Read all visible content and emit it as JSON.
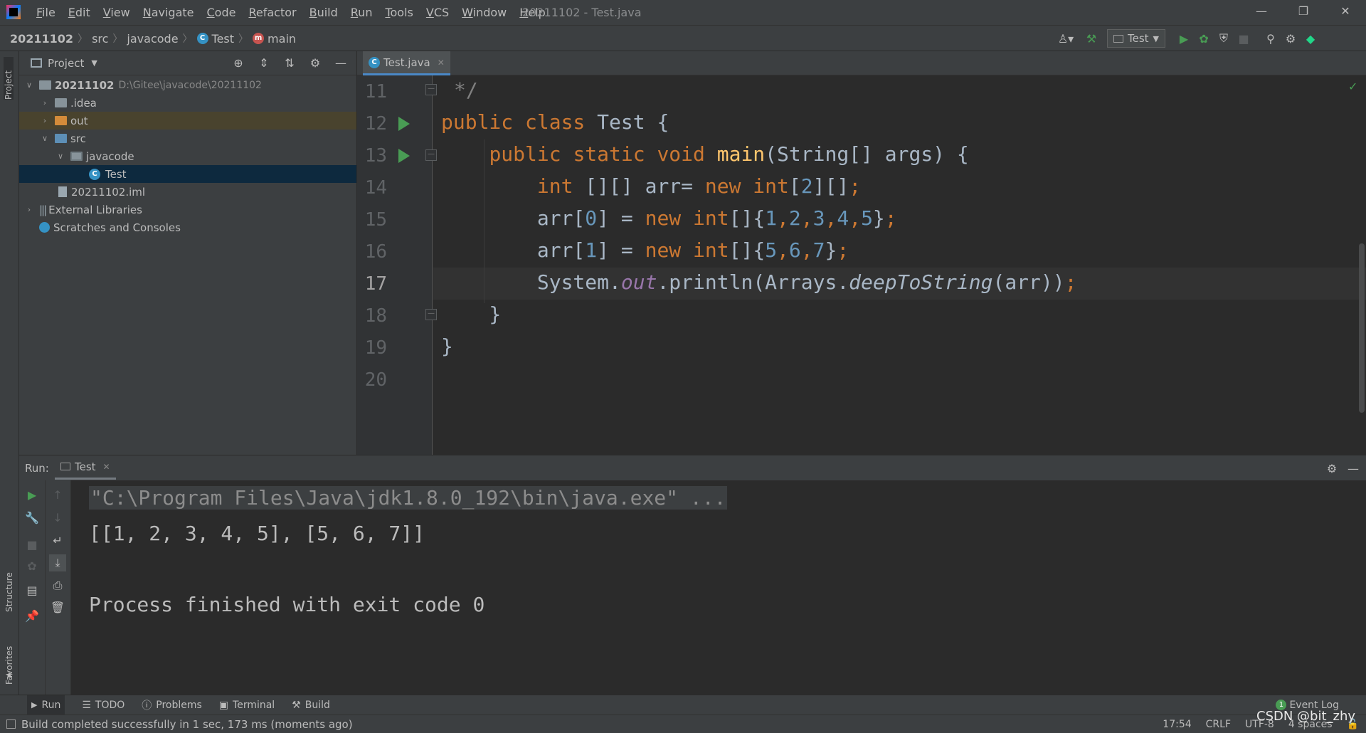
{
  "menu": [
    "File",
    "Edit",
    "View",
    "Navigate",
    "Code",
    "Refactor",
    "Build",
    "Run",
    "Tools",
    "VCS",
    "Window",
    "Help"
  ],
  "window_title": "20211102 - Test.java",
  "breadcrumb": [
    "20211102",
    "src",
    "javacode",
    "Test",
    "main"
  ],
  "run_config": "Test",
  "project_panel": {
    "title": "Project",
    "root_name": "20211102",
    "root_path": "D:\\Gitee\\javacode\\20211102",
    "items": [
      ".idea",
      "out",
      "src",
      "javacode",
      "Test",
      "20211102.iml",
      "External Libraries",
      "Scratches and Consoles"
    ]
  },
  "editor": {
    "tab": "Test.java",
    "line_numbers": [
      "11",
      "12",
      "13",
      "14",
      "15",
      "16",
      "17",
      "18",
      "19",
      "20"
    ],
    "current_line": "17"
  },
  "run_panel": {
    "label": "Run:",
    "tab": "Test",
    "command": "\"C:\\Program Files\\Java\\jdk1.8.0_192\\bin\\java.exe\" ...",
    "output": "[[1, 2, 3, 4, 5], [5, 6, 7]]",
    "exit_message": "Process finished with exit code 0"
  },
  "left_strip": [
    "Project",
    "Structure",
    "Favorites"
  ],
  "tool_windows": [
    "Run",
    "TODO",
    "Problems",
    "Terminal",
    "Build"
  ],
  "event_log": {
    "label": "Event Log",
    "count": "1"
  },
  "status": {
    "message": "Build completed successfully in 1 sec, 173 ms (moments ago)",
    "position": "17:54",
    "line_ending": "CRLF",
    "encoding": "UTF-8",
    "indent": "4 spaces",
    "watermark": "CSDN @bit_zhy"
  },
  "colors": {
    "keyword": "#cc7832",
    "number": "#6897bb",
    "method": "#ffc66d",
    "static_field": "#9876aa",
    "run_green": "#499c54",
    "accent": "#4a88c7"
  }
}
